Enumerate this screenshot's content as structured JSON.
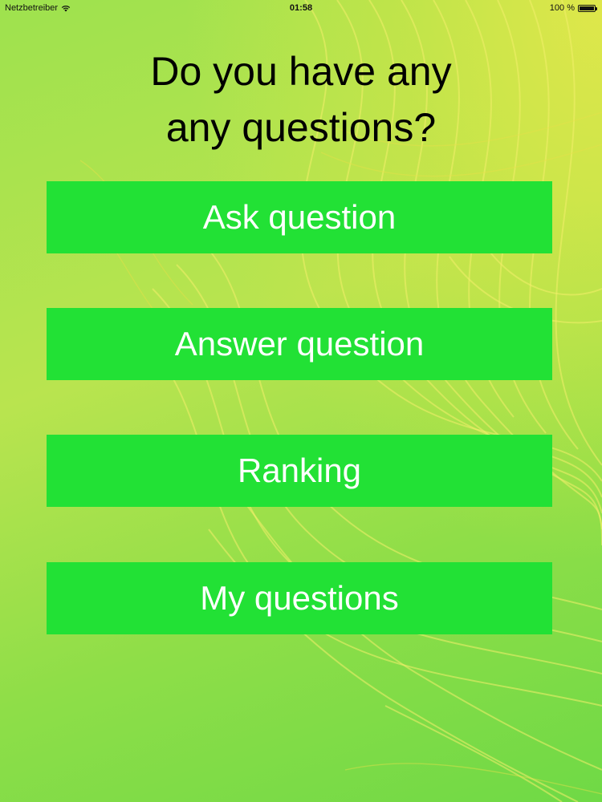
{
  "status_bar": {
    "carrier": "Netzbetreiber",
    "time": "01:58",
    "battery": "100 %",
    "wifi_icon": "wifi-icon",
    "battery_icon": "battery-icon"
  },
  "title": {
    "line1": "Do you have any",
    "line2": "any questions?"
  },
  "buttons": {
    "ask": "Ask question",
    "answer": "Answer question",
    "ranking": "Ranking",
    "my_questions": "My questions"
  },
  "colors": {
    "button_bg": "#22e135",
    "button_text": "#ffffff",
    "title_text": "#000000"
  }
}
